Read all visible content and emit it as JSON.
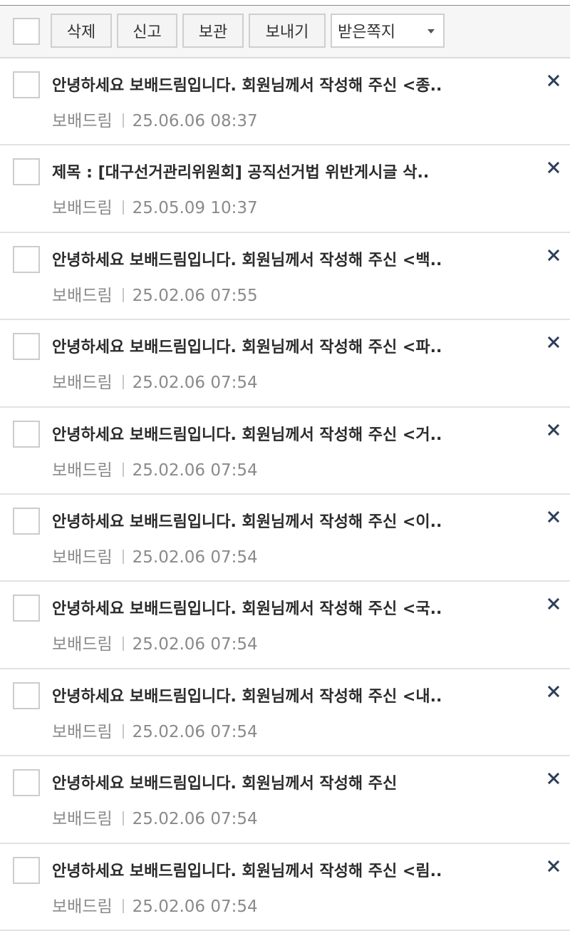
{
  "toolbar": {
    "buttons": [
      "삭제",
      "신고",
      "보관",
      "보내기"
    ],
    "select_value": "받은쪽지"
  },
  "messages": [
    {
      "subject": "안녕하세요 보배드림입니다. 회원님께서 작성해 주신 <종..",
      "sender": "보배드림",
      "date": "25.06.06 08:37"
    },
    {
      "subject": "제목 :  [대구선거관리위원회]  공직선거법 위반게시글 삭..",
      "sender": "보배드림",
      "date": "25.05.09 10:37"
    },
    {
      "subject": "안녕하세요 보배드림입니다. 회원님께서 작성해 주신 <백..",
      "sender": "보배드림",
      "date": "25.02.06 07:55"
    },
    {
      "subject": "안녕하세요 보배드림입니다. 회원님께서 작성해 주신 <파..",
      "sender": "보배드림",
      "date": "25.02.06 07:54"
    },
    {
      "subject": "안녕하세요 보배드림입니다. 회원님께서 작성해 주신 <거..",
      "sender": "보배드림",
      "date": "25.02.06 07:54"
    },
    {
      "subject": "안녕하세요 보배드림입니다. 회원님께서 작성해 주신 <이..",
      "sender": "보배드림",
      "date": "25.02.06 07:54"
    },
    {
      "subject": "안녕하세요 보배드림입니다. 회원님께서 작성해 주신 <국..",
      "sender": "보배드림",
      "date": "25.02.06 07:54"
    },
    {
      "subject": "안녕하세요 보배드림입니다. 회원님께서 작성해 주신 <내..",
      "sender": "보배드림",
      "date": "25.02.06 07:54"
    },
    {
      "subject": "안녕하세요 보배드림입니다. 회원님께서 작성해 주신",
      "sender": "보배드림",
      "date": "25.02.06 07:54"
    },
    {
      "subject": "안녕하세요 보배드림입니다. 회원님께서 작성해 주신 <림..",
      "sender": "보배드림",
      "date": "25.02.06 07:54"
    }
  ],
  "icons": {
    "delete_message": "close-icon",
    "select_caret": "caret-down-icon"
  },
  "colors": {
    "close_icon": "#2c3e5a",
    "subject_text": "#2b2b2b",
    "meta_text": "#8a8a8a"
  }
}
